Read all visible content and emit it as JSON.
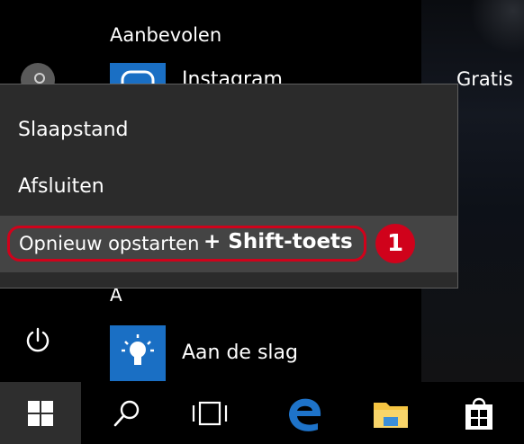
{
  "start_menu": {
    "section_title": "Aanbevolen",
    "recommended": [
      {
        "label": "Instagram",
        "price": "Gratis"
      }
    ],
    "letter_heading": "A",
    "apps": [
      {
        "label": "Aan de slag"
      }
    ]
  },
  "power_menu": {
    "items": [
      {
        "label": "Slaapstand"
      },
      {
        "label": "Afsluiten"
      },
      {
        "label": "Opnieuw opstarten",
        "annotation": "+ Shift-toets"
      }
    ],
    "step_badge": "1"
  },
  "colors": {
    "menu_bg": "#2b2b2b",
    "highlight_row": "#444444",
    "annotation_red": "#d0021b",
    "tile_blue": "#1a6fc4",
    "edge_blue": "#1e73c9",
    "folder_yellow": "#f5c542"
  },
  "icons": {
    "user": "avatar-icon",
    "power": "power-icon",
    "start": "windows-logo-icon",
    "search": "search-icon",
    "task_view": "task-view-icon",
    "edge": "edge-browser-icon",
    "explorer": "file-explorer-icon",
    "store": "store-icon",
    "tips": "lightbulb-icon"
  }
}
